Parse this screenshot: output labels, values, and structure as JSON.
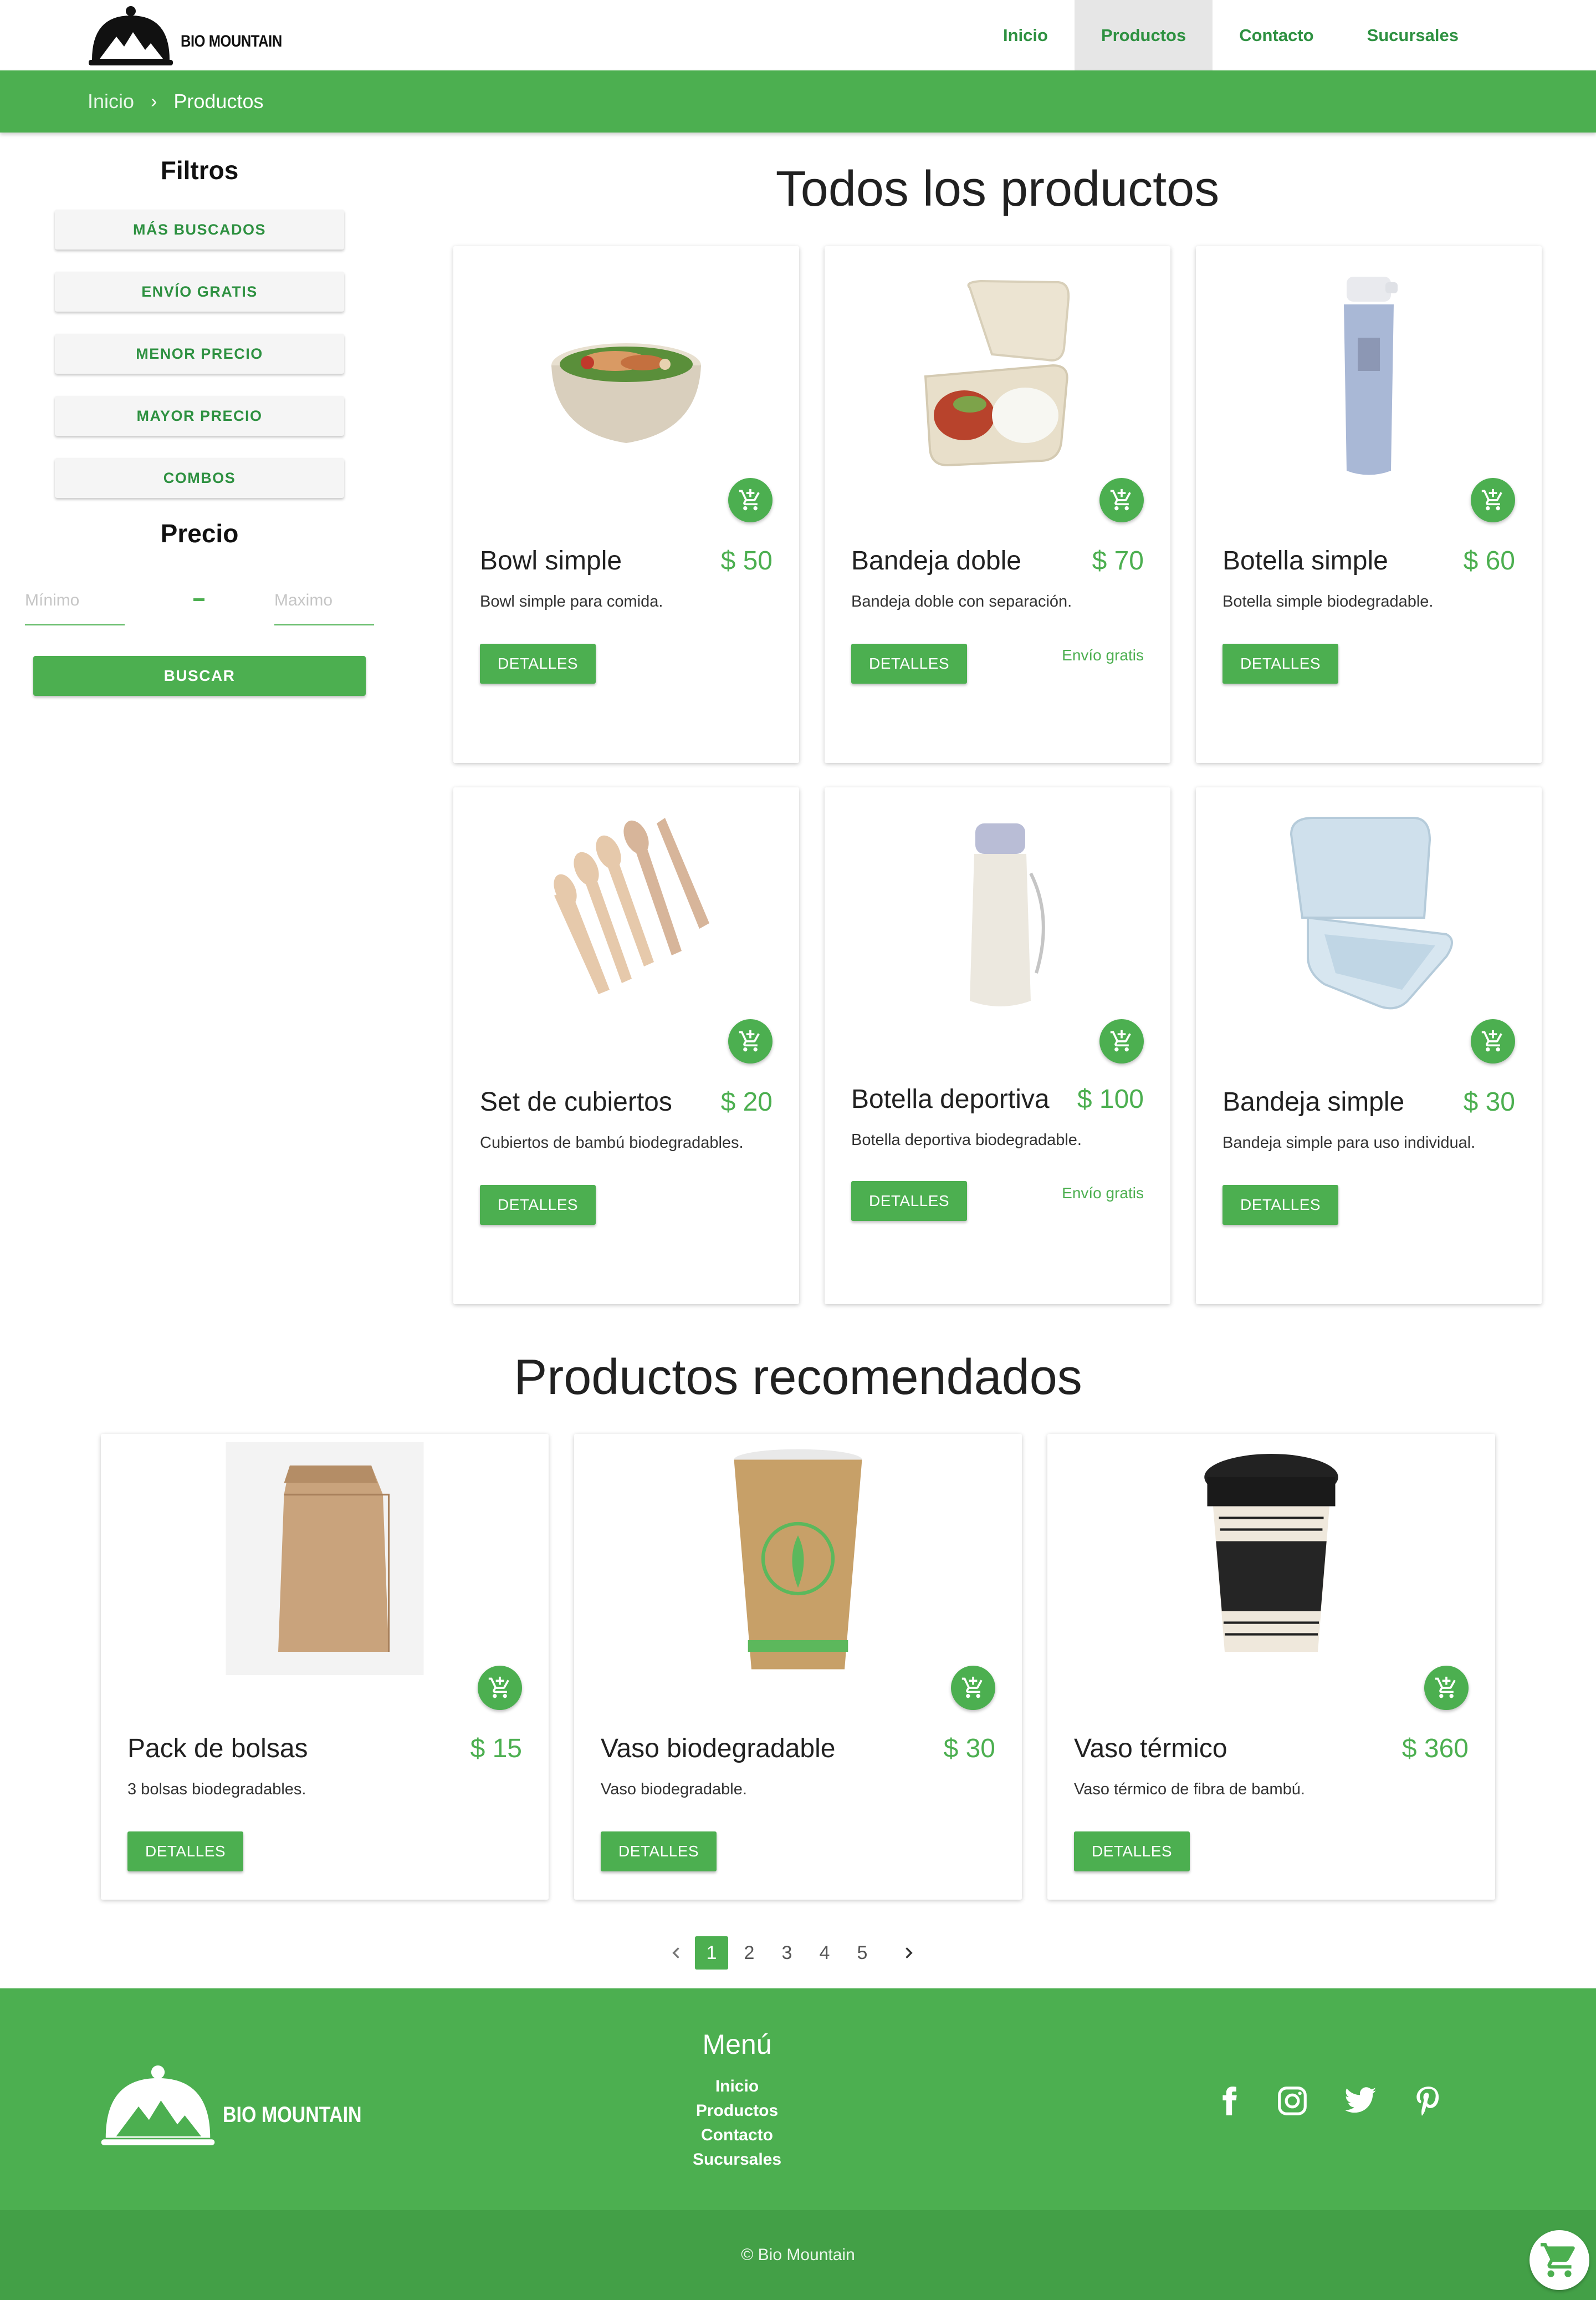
{
  "brand": {
    "name": "BIO MOUNTAIN"
  },
  "nav": [
    {
      "label": "Inicio"
    },
    {
      "label": "Productos"
    },
    {
      "label": "Contacto"
    },
    {
      "label": "Sucursales"
    }
  ],
  "breadcrumb": {
    "home": "Inicio",
    "separator": "›",
    "current": "Productos"
  },
  "sidebar": {
    "filters_title": "Filtros",
    "filters": [
      "MÁS BUSCADOS",
      "ENVÍO GRATIS",
      "MENOR PRECIO",
      "MAYOR PRECIO",
      "COMBOS"
    ],
    "price_title": "Precio",
    "min_placeholder": "Mínimo",
    "max_placeholder": "Maximo",
    "dash": "-",
    "search_label": "BUSCAR"
  },
  "all_products": {
    "title": "Todos los productos",
    "items": [
      {
        "name": "Bowl simple",
        "price": "$ 50",
        "desc": "Bowl simple para comida.",
        "details": "DETALLES",
        "free_shipping": "",
        "icon": "bowl-image"
      },
      {
        "name": "Bandeja doble",
        "price": "$ 70",
        "desc": "Bandeja doble con separación.",
        "details": "DETALLES",
        "free_shipping": "Envío gratis",
        "icon": "double-tray-image"
      },
      {
        "name": "Botella simple",
        "price": "$ 60",
        "desc": "Botella simple biodegradable.",
        "details": "DETALLES",
        "free_shipping": "",
        "icon": "bottle-image"
      },
      {
        "name": "Set de cubiertos",
        "price": "$ 20",
        "desc": "Cubiertos de bambú biodegradables.",
        "details": "DETALLES",
        "free_shipping": "",
        "icon": "cutlery-image"
      },
      {
        "name": "Botella deportiva",
        "price": "$ 100",
        "desc": "Botella deportiva biodegradable.",
        "details": "DETALLES",
        "free_shipping": "Envío gratis",
        "icon": "sport-bottle-image"
      },
      {
        "name": "Bandeja simple",
        "price": "$ 30",
        "desc": "Bandeja simple para uso individual.",
        "details": "DETALLES",
        "free_shipping": "",
        "icon": "tray-image"
      }
    ]
  },
  "recommended": {
    "title": "Productos recomendados",
    "items": [
      {
        "name": "Pack de bolsas",
        "price": "$ 15",
        "desc": "3 bolsas biodegradables.",
        "details": "DETALLES",
        "icon": "paper-bag-image"
      },
      {
        "name": "Vaso biodegradable",
        "price": "$ 30",
        "desc": "Vaso biodegradable.",
        "details": "DETALLES",
        "icon": "paper-cup-image"
      },
      {
        "name": "Vaso térmico",
        "price": "$ 360",
        "desc": "Vaso térmico de fibra de bambú.",
        "details": "DETALLES",
        "icon": "thermal-cup-image"
      }
    ]
  },
  "pagination": {
    "pages": [
      "1",
      "2",
      "3",
      "4",
      "5"
    ],
    "current": "1"
  },
  "footer": {
    "brand": "BIO MOUNTAIN",
    "menu_title": "Menú",
    "links": [
      "Inicio",
      "Productos",
      "Contacto",
      "Sucursales"
    ],
    "social": [
      "facebook-icon",
      "instagram-icon",
      "twitter-icon",
      "pinterest-icon"
    ],
    "copyright": "© Bio Mountain"
  },
  "colors": {
    "primary": "#4caf50",
    "primary_dark": "#2e9141",
    "footer_bottom": "#43a047"
  }
}
